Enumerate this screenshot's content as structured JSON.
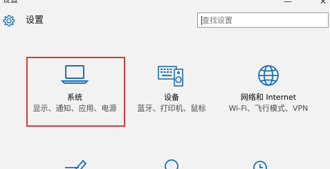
{
  "window": {
    "title": "设置",
    "minimize_glyph": "—",
    "close_glyph": "✕"
  },
  "header": {
    "icon": "gear-icon",
    "title": "设置"
  },
  "search": {
    "placeholder": "查找设置",
    "value": ""
  },
  "categories": [
    {
      "id": "system",
      "icon": "laptop-icon",
      "label": "系统",
      "description": "显示、通知、应用、电源",
      "highlighted": true
    },
    {
      "id": "devices",
      "icon": "keyboard-speaker-icon",
      "label": "设备",
      "description": "蓝牙、打印机、鼠标",
      "highlighted": false
    },
    {
      "id": "network",
      "icon": "globe-icon",
      "label": "网络和 Internet",
      "description": "Wi-Fi、飞行模式、VPN",
      "highlighted": false
    }
  ],
  "partial_row_icons": [
    "pen-icon",
    "person-icon",
    "clock-icon"
  ],
  "colors": {
    "accent": "#1a6fb5",
    "highlight": "#d13a3a",
    "background": "#f2f2f2"
  }
}
